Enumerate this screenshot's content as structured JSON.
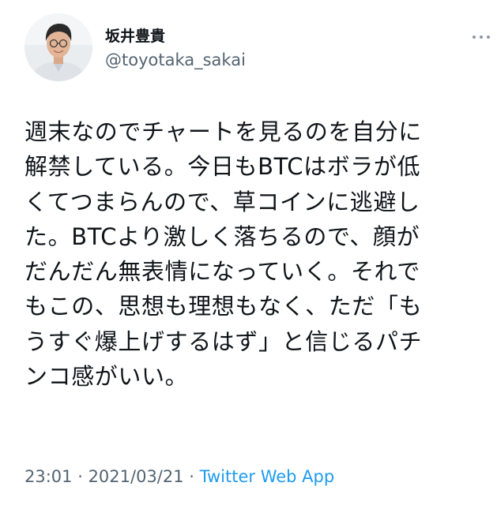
{
  "author": {
    "display_name": "坂井豊貴",
    "handle": "@toyotaka_sakai"
  },
  "icons": {
    "more": "more-horizontal-icon"
  },
  "tweet": {
    "lines": [
      "週末なのでチャートを見るのを自分に",
      "解禁している。今日もBTCはボラが低",
      "くてつまらんので、草コインに逃避し",
      "た。BTCより激しく落ちるので、顔が",
      "だんだん無表情になっていく。それで",
      "もこの、思想も理想もなく、ただ「も",
      "うすぐ爆上げするはず」と信じるパチ",
      "ンコ感がいい。"
    ]
  },
  "meta": {
    "time": "23:01",
    "separator1": " · ",
    "date": "2021/03/21",
    "separator2": " · ",
    "source": "Twitter Web App"
  },
  "colors": {
    "text": "#0f1419",
    "secondary": "#536471",
    "link": "#1d9bf0"
  }
}
